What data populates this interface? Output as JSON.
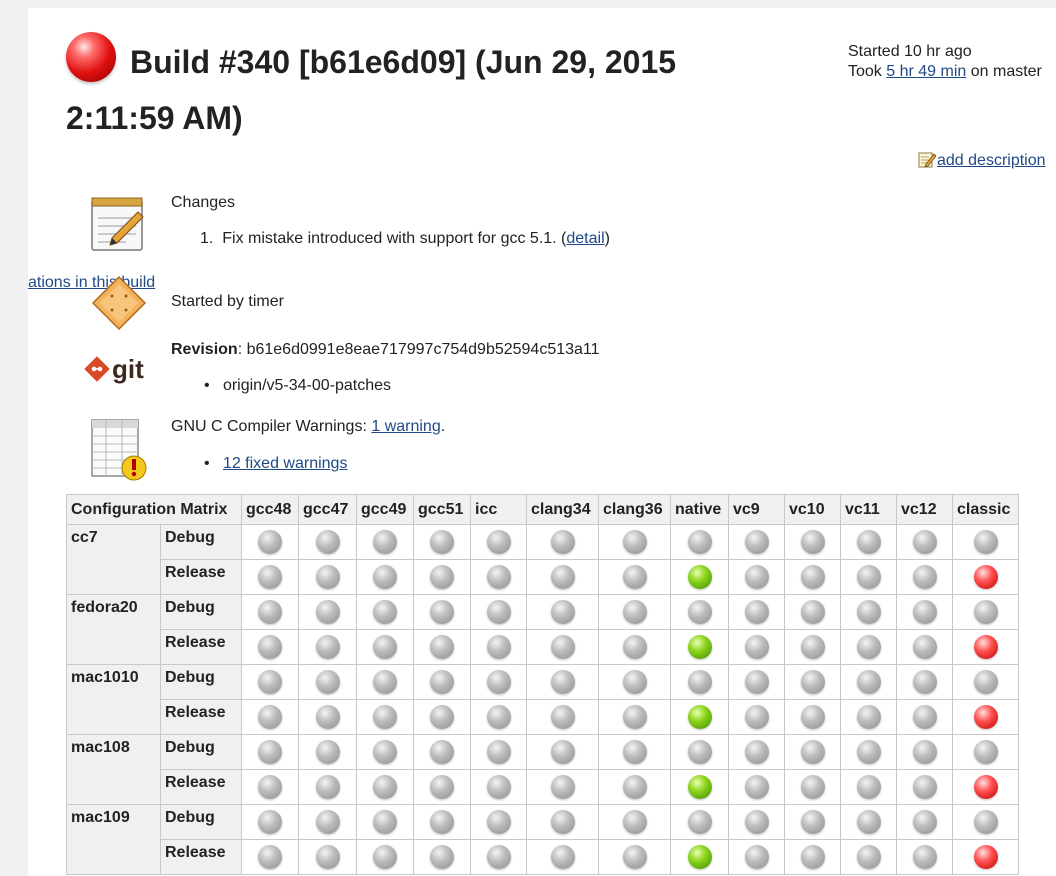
{
  "build": {
    "title": "Build #340 [b61e6d09] (Jun 29, 2015 2:11:59 AM)",
    "started_text": "Started 10 hr ago",
    "took_prefix": "Took ",
    "took_link": "5 hr 49 min",
    "took_suffix": " on master",
    "add_description": "add description"
  },
  "side_link": "ations in this build",
  "changes": {
    "heading": "Changes",
    "item_number": "1.",
    "item_text": "Fix mistake introduced with support for gcc 5.1. (",
    "item_link": "detail",
    "item_close": ")"
  },
  "cause": {
    "text": "Started by timer"
  },
  "git": {
    "icon_label": "git",
    "revision_label": "Revision",
    "revision_sep": ": ",
    "revision_hash": "b61e6d0991e8eae717997c754d9b52594c513a11",
    "branch": "origin/v5-34-00-patches"
  },
  "warnings": {
    "text": "GNU C Compiler Warnings: ",
    "link": "1 warning",
    "suffix": ".",
    "fixed_link": "12 fixed warnings"
  },
  "matrix": {
    "header": "Configuration Matrix",
    "columns": [
      "gcc48",
      "gcc47",
      "gcc49",
      "gcc51",
      "icc",
      "clang34",
      "clang36",
      "native",
      "vc9",
      "vc10",
      "vc11",
      "vc12",
      "classic"
    ],
    "column_widths": [
      57,
      58,
      57,
      57,
      56,
      72,
      72,
      58,
      56,
      56,
      56,
      56,
      66
    ],
    "platforms": [
      {
        "name": "cc7",
        "rows": [
          {
            "build": "Debug",
            "statuses": [
              "grey",
              "grey",
              "grey",
              "grey",
              "grey",
              "grey",
              "grey",
              "grey",
              "grey",
              "grey",
              "grey",
              "grey",
              "grey"
            ]
          },
          {
            "build": "Release",
            "statuses": [
              "grey",
              "grey",
              "grey",
              "grey",
              "grey",
              "grey",
              "grey",
              "green",
              "grey",
              "grey",
              "grey",
              "grey",
              "red"
            ]
          }
        ]
      },
      {
        "name": "fedora20",
        "rows": [
          {
            "build": "Debug",
            "statuses": [
              "grey",
              "grey",
              "grey",
              "grey",
              "grey",
              "grey",
              "grey",
              "grey",
              "grey",
              "grey",
              "grey",
              "grey",
              "grey"
            ]
          },
          {
            "build": "Release",
            "statuses": [
              "grey",
              "grey",
              "grey",
              "grey",
              "grey",
              "grey",
              "grey",
              "green",
              "grey",
              "grey",
              "grey",
              "grey",
              "red"
            ]
          }
        ]
      },
      {
        "name": "mac1010",
        "rows": [
          {
            "build": "Debug",
            "statuses": [
              "grey",
              "grey",
              "grey",
              "grey",
              "grey",
              "grey",
              "grey",
              "grey",
              "grey",
              "grey",
              "grey",
              "grey",
              "grey"
            ]
          },
          {
            "build": "Release",
            "statuses": [
              "grey",
              "grey",
              "grey",
              "grey",
              "grey",
              "grey",
              "grey",
              "green",
              "grey",
              "grey",
              "grey",
              "grey",
              "red"
            ]
          }
        ]
      },
      {
        "name": "mac108",
        "rows": [
          {
            "build": "Debug",
            "statuses": [
              "grey",
              "grey",
              "grey",
              "grey",
              "grey",
              "grey",
              "grey",
              "grey",
              "grey",
              "grey",
              "grey",
              "grey",
              "grey"
            ]
          },
          {
            "build": "Release",
            "statuses": [
              "grey",
              "grey",
              "grey",
              "grey",
              "grey",
              "grey",
              "grey",
              "green",
              "grey",
              "grey",
              "grey",
              "grey",
              "red"
            ]
          }
        ]
      },
      {
        "name": "mac109",
        "rows": [
          {
            "build": "Debug",
            "statuses": [
              "grey",
              "grey",
              "grey",
              "grey",
              "grey",
              "grey",
              "grey",
              "grey",
              "grey",
              "grey",
              "grey",
              "grey",
              "grey"
            ]
          },
          {
            "build": "Release",
            "statuses": [
              "grey",
              "grey",
              "grey",
              "grey",
              "grey",
              "grey",
              "grey",
              "green",
              "grey",
              "grey",
              "grey",
              "grey",
              "red"
            ]
          }
        ]
      }
    ]
  },
  "colors": {
    "link": "#204a87",
    "status_failed": "#e01010",
    "status_success": "#8cd31c",
    "status_notbuilt": "#bdbdbd"
  }
}
